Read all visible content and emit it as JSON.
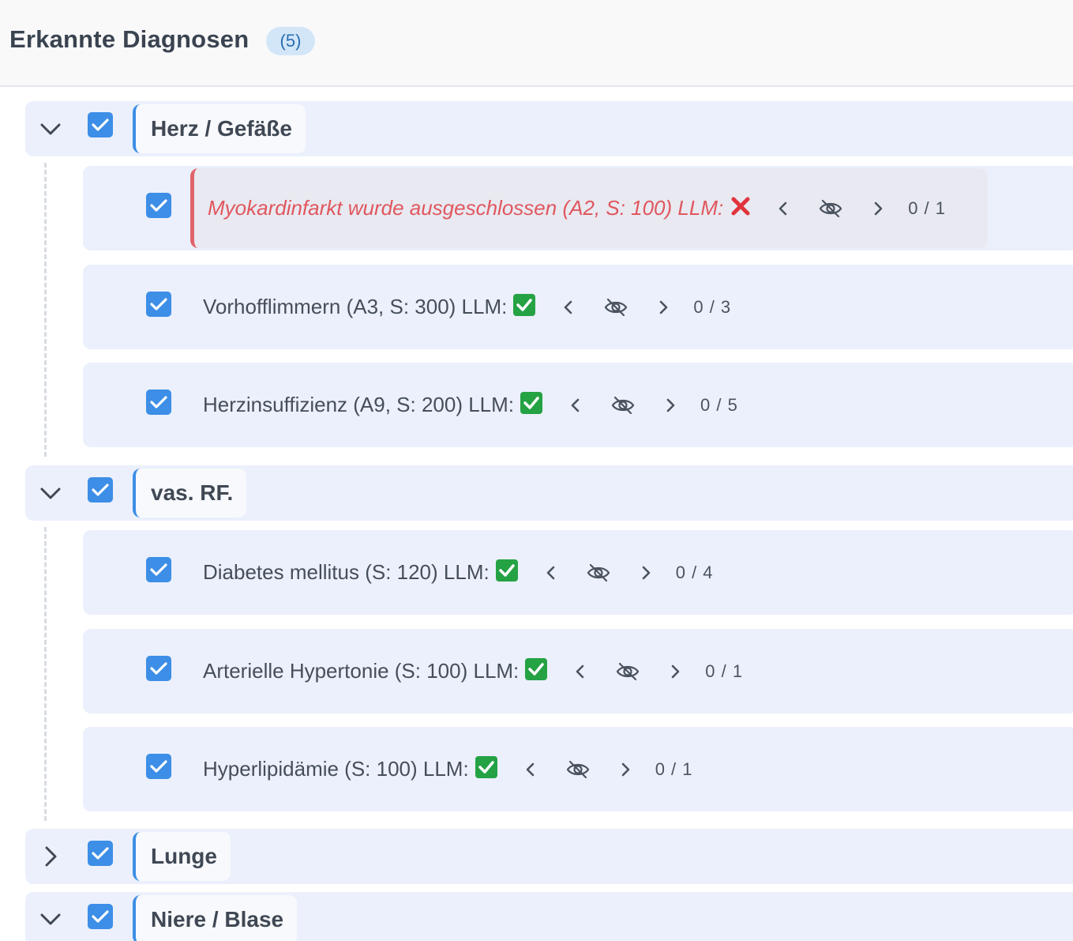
{
  "header": {
    "title": "Erkannte Diagnosen",
    "count": "(5)"
  },
  "groups": [
    {
      "label": "Herz / Gefäße",
      "expanded": true,
      "items": [
        {
          "text": "Myokardinfarkt wurde ausgeschlossen (A2, S: 100) LLM:",
          "llm": "fail",
          "pager": "0 / 1",
          "excluded": true
        },
        {
          "text": "Vorhofflimmern (A3, S: 300) LLM:",
          "llm": "ok",
          "pager": "0 / 3"
        },
        {
          "text": "Herzinsuffizienz (A9, S: 200) LLM:",
          "llm": "ok",
          "pager": "0 / 5"
        }
      ]
    },
    {
      "label": "vas. RF.",
      "expanded": true,
      "items": [
        {
          "text": "Diabetes mellitus (S: 120) LLM:",
          "llm": "ok",
          "pager": "0 / 4"
        },
        {
          "text": "Arterielle Hypertonie (S: 100) LLM:",
          "llm": "ok",
          "pager": "0 / 1"
        },
        {
          "text": "Hyperlipidämie (S: 100) LLM:",
          "llm": "ok",
          "pager": "0 / 1"
        }
      ]
    },
    {
      "label": "Lunge",
      "expanded": false,
      "items": []
    },
    {
      "label": "Niere / Blase",
      "expanded": true,
      "items": []
    }
  ],
  "colors": {
    "accent": "#3d8ee6",
    "llm_ok": "#25a244",
    "llm_fail": "#e0343c",
    "excluded": "#e0575e"
  },
  "icons": {
    "expanded": "chevron-down-icon",
    "collapsed": "chevron-right-icon",
    "prev": "chevron-left-icon",
    "next": "chevron-right-icon",
    "visibility": "eye-off-icon"
  }
}
